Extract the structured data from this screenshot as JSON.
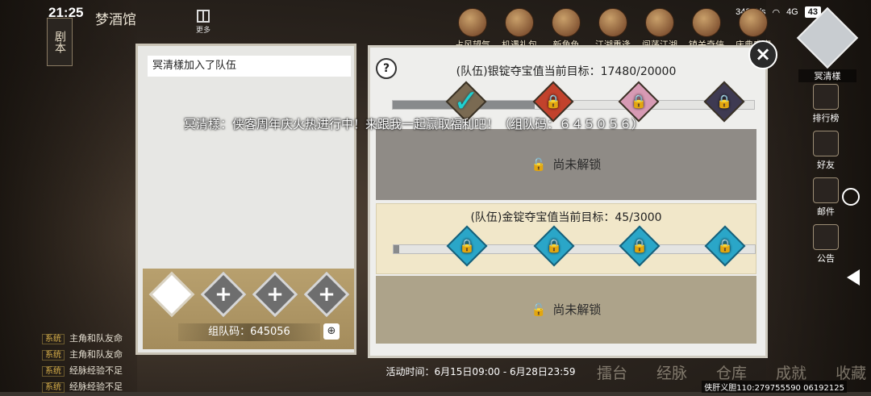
{
  "status_bar": {
    "time": "21:25",
    "net_speed": "342 B/s",
    "signal": "4G",
    "battery": "43"
  },
  "scene": {
    "title": "梦酒馆",
    "more_label": "更多",
    "script_tab": "剧本"
  },
  "top_bar": {
    "icons": [
      {
        "label": "占风望气",
        "icon": "fortune-icon"
      },
      {
        "label": "机遇礼包",
        "icon": "gift-icon"
      },
      {
        "label": "新角色",
        "icon": "character-icon"
      },
      {
        "label": "江湖重逢",
        "icon": "reunion-icon"
      },
      {
        "label": "闯荡江湖",
        "icon": "adventure-icon"
      },
      {
        "label": "镇关奇侠",
        "icon": "hero-icon"
      },
      {
        "label": "庆典盛宴",
        "icon": "feast-icon"
      }
    ]
  },
  "player": {
    "name": "冥清樣"
  },
  "right_menu": [
    {
      "label": "排行榜",
      "icon": "ranking-icon"
    },
    {
      "label": "好友",
      "icon": "friends-icon"
    },
    {
      "label": "邮件",
      "icon": "mail-icon"
    },
    {
      "label": "公告",
      "icon": "notice-icon"
    }
  ],
  "chat": [
    {
      "tag": "系统",
      "text": "主角和队友命"
    },
    {
      "tag": "系统",
      "text": "主角和队友命"
    },
    {
      "tag": "系统",
      "text": "经脉经验不足"
    },
    {
      "tag": "系统",
      "text": "经脉经验不足"
    }
  ],
  "bottom_nav": [
    "擂台",
    "经脉",
    "仓库",
    "成就",
    "收藏"
  ],
  "uid_text": "侠肝义胆110:279755590 06192125",
  "team_panel": {
    "join_message": "冥清樣加入了队伍",
    "team_code_label": "组队码：645056",
    "zoom_icon": "magnifier-icon"
  },
  "reward_panel": {
    "silver": {
      "title": "(队伍)银锭夺宝值当前目标：17480/20000",
      "current": 17480,
      "target": 20000
    },
    "gold": {
      "title": "(队伍)金锭夺宝值当前目标：45/3000",
      "current": 45,
      "target": 3000
    },
    "locked_label": "尚未解锁",
    "event_time": "活动时间：6月15日09:00 - 6月28日23:59"
  },
  "broadcast": "冥清樣：侠客周年庆火热进行中！来跟我一起赢取福利吧！（组队码：６４５０５６）",
  "colors": {
    "gold_section_bg": "#f1e7c9",
    "locked_band": "#8f8b86",
    "panel_bg": "#eeeeec"
  }
}
